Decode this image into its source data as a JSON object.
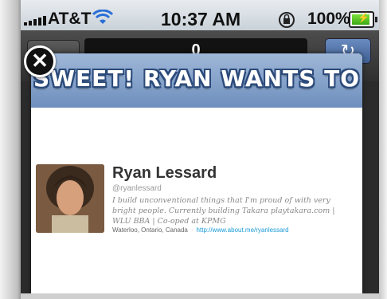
{
  "status_bar": {
    "carrier": "AT&T",
    "time": "10:37 AM",
    "battery": "100%"
  },
  "navbar": {
    "url_text": "0"
  },
  "dialog": {
    "title": "SWEET! RYAN WANTS TO",
    "close_label": "✕",
    "profile": {
      "name": "Ryan Lessard",
      "handle": "@ryanlessard",
      "bio": "I build unconventional things that I'm proud of with very bright people. Currently building Takara playtakara.com | WLU BBA | Co-oped at KPMG",
      "location": "Waterloo, Ontario, Canada",
      "separator": "·",
      "url": "http://www.about.me/ryanlessard"
    }
  },
  "colors": {
    "header_top": "#9fb7d8",
    "header_bottom": "#6e8fbd",
    "link": "#1a9bd6"
  }
}
